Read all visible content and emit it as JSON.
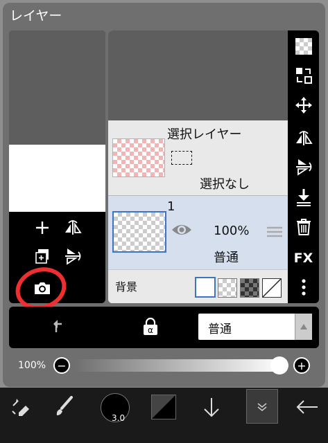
{
  "title": "レイヤー",
  "selection_layer": {
    "name": "選択レイヤー",
    "status": "選択なし"
  },
  "layer1": {
    "name": "1",
    "opacity": "100%",
    "blend": "普通"
  },
  "background_row": {
    "label": "背景"
  },
  "blend_bar": {
    "mode": "普通"
  },
  "opacity_bar": {
    "value_label": "100%",
    "minus": "−",
    "plus": "+",
    "level": 1.0
  },
  "right_bar": {
    "fx_label": "FX"
  },
  "bottom": {
    "brush_size": "3.0"
  },
  "colors": {
    "accent_blue": "#3b73c9",
    "annotation_red": "#ee2f2f"
  }
}
